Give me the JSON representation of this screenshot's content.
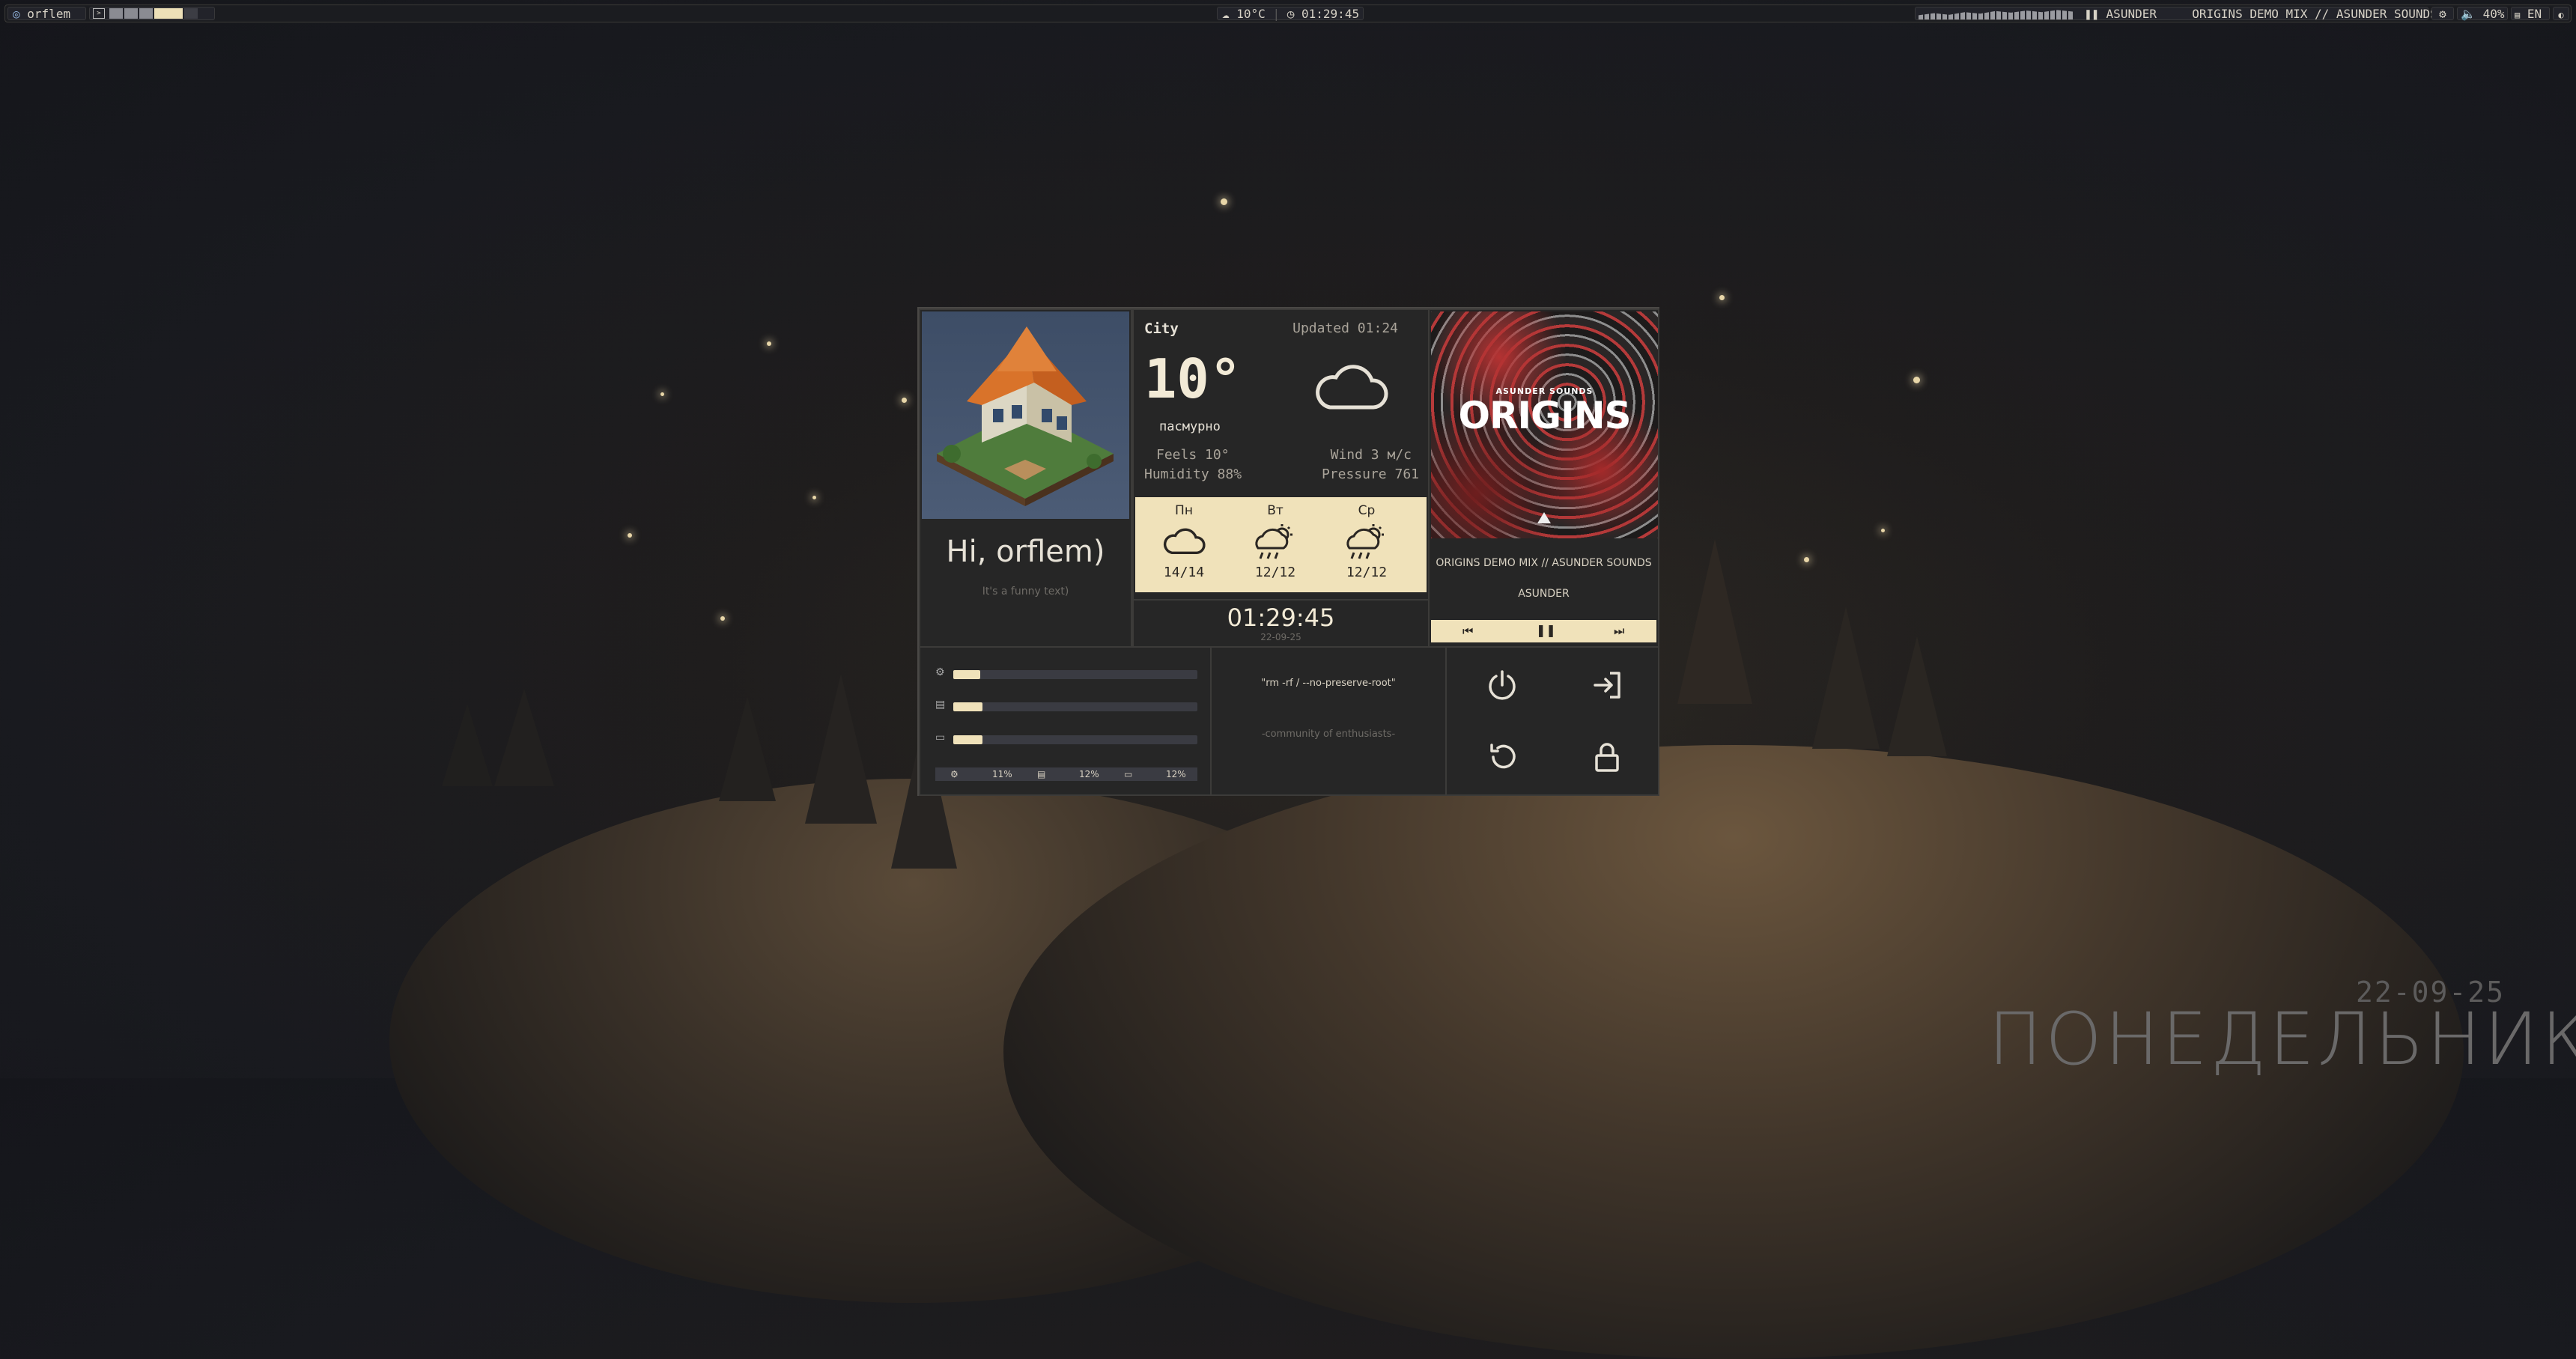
{
  "topbar": {
    "user": "orflem",
    "weather_temp": "10°C",
    "clock": "01:29:45",
    "media_artist": "ASUNDER",
    "media_title": "ORIGINS DEMO MIX // ASUNDER SOUNDS",
    "volume": "40%",
    "language": "EN"
  },
  "profile": {
    "greeting": "Hi, orflem)",
    "subtitle": "It's a funny text)"
  },
  "weather": {
    "city": "City",
    "updated": "Updated 01:24",
    "temp": "10°",
    "condition": "пасмурно",
    "feels": "Feels 10°",
    "humidity": "Humidity 88%",
    "wind": "Wind 3 м/с",
    "pressure": "Pressure 761",
    "forecast": [
      {
        "day": "Пн",
        "temps": "14/14",
        "icon": "cloud-icon"
      },
      {
        "day": "Вт",
        "temps": "12/12",
        "icon": "sun-rain-icon"
      },
      {
        "day": "Ср",
        "temps": "12/12",
        "icon": "sun-rain-icon"
      }
    ]
  },
  "clock": {
    "time": "01:29:45",
    "date": "22-09-25"
  },
  "music": {
    "album_label": "ASUNDER SOUNDS",
    "album_title": "ORIGINS",
    "title": "ORIGINS DEMO MIX // ASUNDER SOUNDS",
    "artist": "ASUNDER"
  },
  "stats": {
    "cpu": 0.11,
    "ram": 0.12,
    "disk": 0.12,
    "cpu_label": "11%",
    "ram_label": "12%",
    "disk_label": "12%"
  },
  "quote": {
    "command": "\"rm -rf / --no-preserve-root\"",
    "caption": "-community of enthusiasts-"
  },
  "desktop": {
    "date": "22-09-25",
    "day": "ПОНЕДЕЛЬНИК"
  },
  "colors": {
    "accent": "#f0e2ba",
    "panel": "#262626",
    "border": "#3c3b39"
  }
}
